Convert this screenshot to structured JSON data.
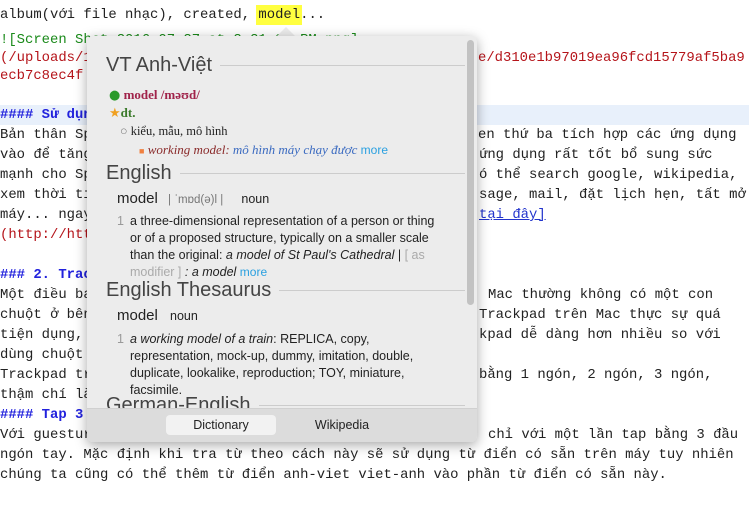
{
  "editor": {
    "l1a": "album(với file nhạc), created, ",
    "l1hl": "model",
    "l1b": "...",
    "l2": "![Screen Shot 2016-07-27 at 2.21.33 PM.png]",
    "l3": "(/uploads/1",
    "l3r": "e/d310e1b97019ea96fcd15779af5ba9",
    "l4": "ecb7c8ec4f",
    "h1": "#### Sử dụng",
    "l5": "Bản thân Sp",
    "l5r": "en thứ ba tích hợp các ứng dụng",
    "l6": "vào để tăng",
    "l6r": "ứng dụng rất tốt bổ sung sức",
    "l7": "mạnh cho Sp",
    "l7r": "ó thể search google, wikipedia,",
    "l8": "xem thời ti",
    "l8r": "sage, mail, đặt lịch hẹn, tất mở",
    "l9": "máy... ngay",
    "l9r": "tại đây]",
    "l10": "(http://htt",
    "h2": "### 2. Trac",
    "l11": "Một điều ba",
    "l11r": "Mac thường không có một con",
    "l12": "chuột ở bên",
    "l12r": "Trackpad trên Mac thực sự quá",
    "l13": "tiện dụng, ",
    "l13r": "kpad dễ dàng hơn nhiều so với",
    "l14": "dùng chuột",
    "l15": "Trackpad tr",
    "l15r": "bằng 1 ngón, 2 ngón, 3 ngón,",
    "l16": "thậm chí là",
    "h3": "#### Tap 3",
    "l17": "Với guestur",
    "l17r": "chỉ với một lần tap bằng 3 đầu",
    "l18": "ngón tay. Mặc định khi tra từ theo cách này sẽ sử dụng từ điển có sẵn trên máy tuy nhiên",
    "l19": "chúng ta cũng có thể thêm từ điển anh-viet viet-anh vào phần từ điển có sẵn này."
  },
  "popover": {
    "vt": {
      "title": "VT Anh-Việt",
      "headword": "model /məʊd/",
      "pos": "dt.",
      "sense": "kiểu, mẫu, mô hình",
      "example_en": "working model:",
      "example_vi": "mô hình máy chạy được",
      "more": "more"
    },
    "english": {
      "title": "English",
      "word": "model",
      "pron": "| ˈmɒd(ə)l |",
      "pos": "noun",
      "num": "1",
      "def": "a three-dimensional representation of a person or thing or of a proposed structure, typically on a smaller scale than the original: ",
      "ex": "a model of St Paul's Cathedral",
      "sep": " | ",
      "mod": "[ as modifier ]",
      "ex2": " : a model",
      "more": "more"
    },
    "thesaurus": {
      "title": "English Thesaurus",
      "word": "model",
      "pos": "noun",
      "num": "1",
      "ex": "a working model of a train",
      "text": ": REPLICA, copy, representation, mock-up, dummy, imitation, double, duplicate, lookalike, reproduction; TOY, miniature, facsimile."
    },
    "german": {
      "title": "German-English"
    },
    "tabs": [
      "Dictionary",
      "Wikipedia"
    ]
  }
}
